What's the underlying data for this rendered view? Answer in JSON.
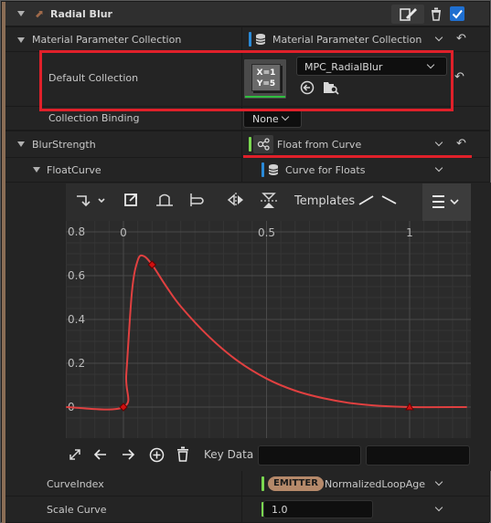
{
  "section": {
    "title": "Radial Blur"
  },
  "mpc": {
    "label": "Material Parameter Collection",
    "value": "Material Parameter Collection",
    "default_label": "Default Collection",
    "asset_thumb_line1": "X=1",
    "asset_thumb_line2": "Y=5",
    "asset_name": "MPC_RadialBlur",
    "binding_label": "Collection Binding",
    "binding_value": "None"
  },
  "blur": {
    "label": "BlurStrength",
    "value": "Float from Curve",
    "curve_label": "FloatCurve",
    "curve_value": "Curve for Floats"
  },
  "curve_editor": {
    "templates_label": "Templates",
    "key_data_label": "Key Data"
  },
  "curve_index": {
    "label": "CurveIndex",
    "badge": "EMITTER",
    "value": "NormalizedLoopAge"
  },
  "scale_curve": {
    "label": "Scale Curve",
    "value": "1.0"
  },
  "colors": {
    "curve": "#e04040",
    "highlight_box": "#e0202a",
    "emitter_badge": "#b5896a",
    "pin_blue": "#2a8ad8",
    "pin_green": "#7ad850"
  },
  "chart_data": {
    "type": "line",
    "x_tick_labels": [
      "0",
      "0.5",
      "1"
    ],
    "y_tick_labels": [
      "0.8",
      "0.6",
      "0.4",
      "0.2",
      "0"
    ],
    "xlim": [
      -0.2,
      1.2
    ],
    "ylim": [
      -0.05,
      0.82
    ],
    "grid": true,
    "series": [
      {
        "x": [
          -0.2,
          0.0,
          0.01,
          0.03,
          0.05,
          0.07,
          0.1,
          0.15,
          0.2,
          0.3,
          0.4,
          0.5,
          0.6,
          0.7,
          0.8,
          0.9,
          1.0,
          1.2
        ],
        "y": [
          0,
          0,
          0.15,
          0.53,
          0.67,
          0.69,
          0.65,
          0.55,
          0.46,
          0.32,
          0.21,
          0.13,
          0.075,
          0.04,
          0.017,
          0.005,
          0,
          0
        ]
      }
    ],
    "keys": [
      {
        "x": 0.0,
        "y": 0.0
      },
      {
        "x": 0.1,
        "y": 0.65
      },
      {
        "x": 1.0,
        "y": 0.0
      }
    ]
  }
}
